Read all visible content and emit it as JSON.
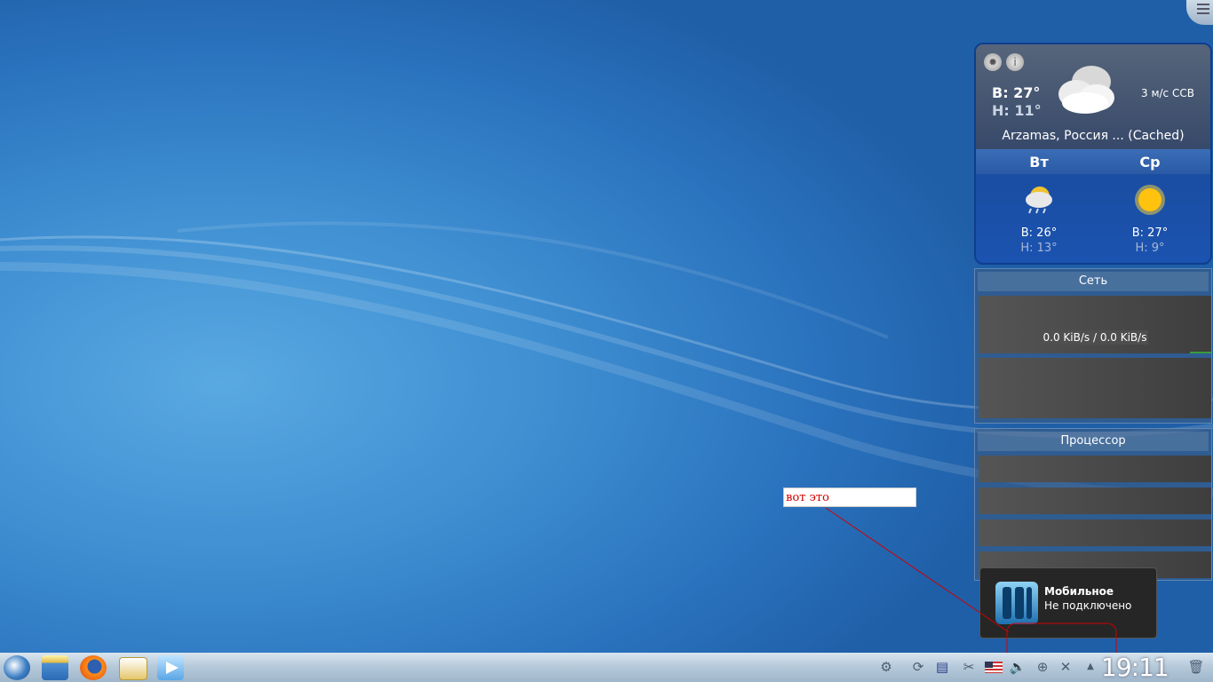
{
  "weather": {
    "today_high": "В: 27°",
    "today_low": "Н: 11°",
    "wind": "3 м/с ССВ",
    "location": "Arzamas, Россия ... (Cached)",
    "forecast": [
      {
        "day": "Вт",
        "high": "В: 26°",
        "low": "Н: 13°",
        "icon": "rain-cloud-icon"
      },
      {
        "day": "Ср",
        "high": "В: 27°",
        "low": "Н: 9°",
        "icon": "sun-icon"
      }
    ]
  },
  "network": {
    "title": "Сеть",
    "rate": "0.0 KiB/s / 0.0 KiB/s"
  },
  "cpu": {
    "title": "Процессор"
  },
  "annotation": {
    "text": "вот это"
  },
  "notification": {
    "title": "Мобильное",
    "status": "Не подключено"
  },
  "taskbar": {
    "clock": "19:11"
  }
}
